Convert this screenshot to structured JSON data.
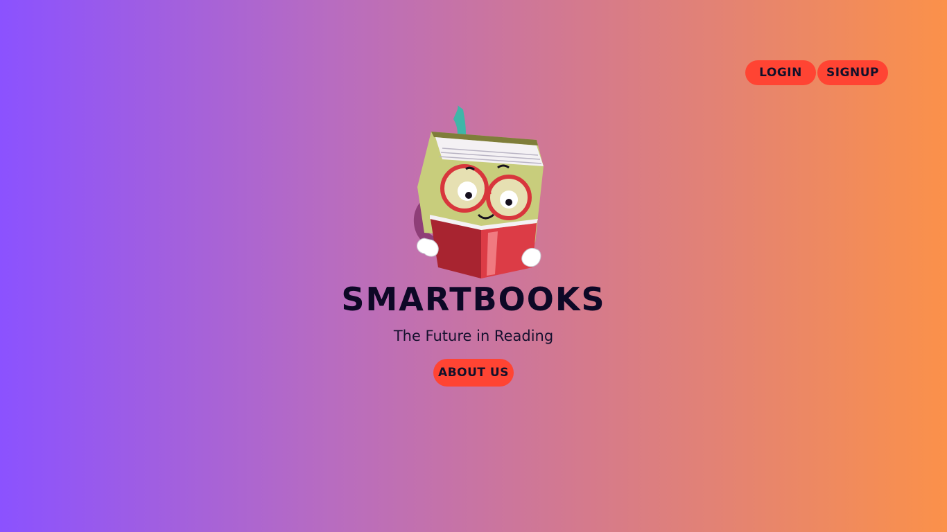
{
  "nav": {
    "login_label": "LOGIN",
    "signup_label": "SIGNUP"
  },
  "hero": {
    "logo_icon": "book-mascot-icon",
    "brand_name": "SMARTBOOKS",
    "tagline": "The Future in Reading",
    "about_label": "ABOUT US"
  },
  "colors": {
    "gradient_start": "#8b52ff",
    "gradient_end": "#fb914a",
    "button_bg": "#ff4433",
    "text_dark": "#0d0826"
  }
}
